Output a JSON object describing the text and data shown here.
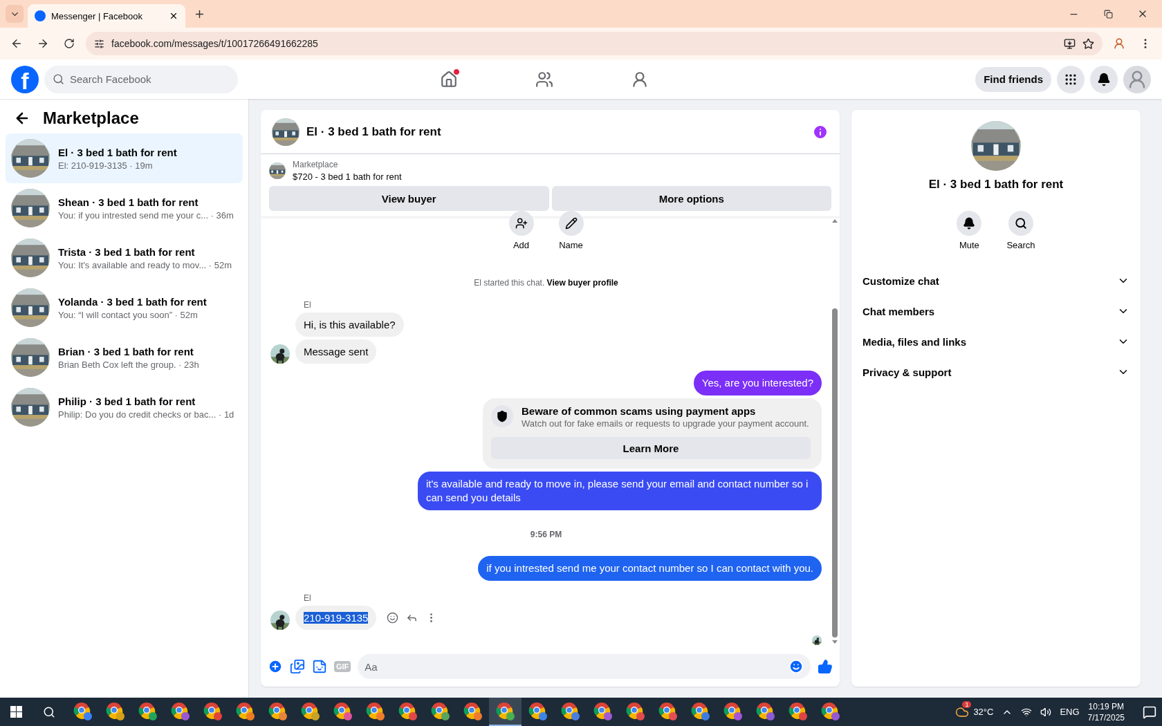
{
  "browser": {
    "tabs": [
      {
        "title": "Messenger | Facebook",
        "selected": true
      }
    ],
    "url": "facebook.com/messages/t/10017266491662285"
  },
  "header": {
    "logo": "f",
    "search_placeholder": "Search Facebook",
    "nav": [
      {
        "kind": "home",
        "badge": true,
        "selected": false
      },
      {
        "kind": "friends",
        "badge": false,
        "selected": false
      },
      {
        "kind": "groups",
        "badge": false,
        "selected": false
      }
    ],
    "find_friends": "Find friends"
  },
  "sidebar": {
    "title": "Marketplace",
    "conversations": [
      {
        "name": "El · 3 bed 1 bath for rent",
        "preview": "El: 210-919-3135 · 19m",
        "selected": true
      },
      {
        "name": "Shean · 3 bed 1 bath for rent",
        "preview": "You: if you intrested send me your c... · 36m",
        "selected": false
      },
      {
        "name": "Trista · 3 bed 1 bath for rent",
        "preview": "You: It's available and ready to mov... · 52m",
        "selected": false
      },
      {
        "name": "Yolanda · 3 bed 1 bath for rent",
        "preview": "You: “I will contact you soon” · 52m",
        "selected": false
      },
      {
        "name": "Brian · 3 bed 1 bath for rent",
        "preview": "Brian Beth Cox left the group. · 23h",
        "selected": false
      },
      {
        "name": "Philip · 3 bed 1 bath for rent",
        "preview": "Philip: Do you do credit checks or bac... · 1d",
        "selected": false
      }
    ]
  },
  "chat": {
    "title": "El · 3 bed 1 bath for rent",
    "listing": {
      "source": "Marketplace",
      "title": "$720 - 3 bed 1 bath for rent"
    },
    "buttons": [
      "View buyer",
      "More options"
    ],
    "quick_actions": [
      {
        "kind": "add",
        "label": "Add"
      },
      {
        "kind": "name",
        "label": "Name"
      }
    ],
    "messages": [
      {
        "kind": "system",
        "text": "El started this chat.",
        "link": "View buyer profile"
      },
      {
        "kind": "incoming",
        "sender": "El",
        "bubbles": [
          {
            "text": "Hi, is this available?",
            "selected": false
          },
          {
            "text": "Message sent",
            "selected": false
          }
        ],
        "actions": false
      },
      {
        "kind": "outgoing",
        "text": "Yes, are you interested?",
        "color": "#7b2ff7"
      },
      {
        "kind": "notice",
        "title": "Beware of common scams using payment apps",
        "body": "Watch out for fake emails or requests to upgrade your payment account.",
        "button": "Learn More"
      },
      {
        "kind": "outgoing",
        "text": "it's available and ready to move in, please send your email and contact number so i can send you details",
        "color": "#3a4bf3"
      },
      {
        "kind": "timestamp",
        "text": "9:56 PM"
      },
      {
        "kind": "outgoing",
        "text": "if you intrested send me your contact number so I can contact with you.",
        "color": "#1f63f1"
      },
      {
        "kind": "incoming",
        "sender": "El",
        "bubbles": [
          {
            "text": "210-919-3135",
            "selected": true
          }
        ],
        "actions": true
      },
      {
        "kind": "seen"
      }
    ],
    "composer": {
      "gif": "GIF",
      "placeholder": "Aa"
    }
  },
  "details": {
    "title": "El · 3 bed 1 bath for rent",
    "actions": [
      {
        "kind": "mute",
        "label": "Mute"
      },
      {
        "kind": "search",
        "label": "Search"
      }
    ],
    "sections": [
      {
        "label": "Customize chat",
        "expanded": false
      },
      {
        "label": "Chat members",
        "expanded": false
      },
      {
        "label": "Media, files and links",
        "expanded": false
      },
      {
        "label": "Privacy & support",
        "expanded": false
      }
    ]
  },
  "taskbar": {
    "apps": [
      {
        "color": "#3b82f6",
        "selected": false
      },
      {
        "color": "#d4a017",
        "selected": false
      },
      {
        "color": "#22a559",
        "selected": false
      },
      {
        "color": "#9b59d0",
        "selected": false
      },
      {
        "color": "#e0443a",
        "selected": false
      },
      {
        "color": "#f07c22",
        "selected": false
      },
      {
        "color": "#e8833a",
        "selected": false
      },
      {
        "color": "#c9a227",
        "selected": false
      },
      {
        "color": "#e0559a",
        "selected": false
      },
      {
        "color": "#ef7d2d",
        "selected": false
      },
      {
        "color": "#e04848",
        "selected": false
      },
      {
        "color": "#58a55c",
        "selected": false
      },
      {
        "color": "#ee7b30",
        "selected": false
      },
      {
        "color": "#4caf50",
        "selected": true
      },
      {
        "color": "#3f83e6",
        "selected": false
      },
      {
        "color": "#4a7fe0",
        "selected": false
      },
      {
        "color": "#a05ad6",
        "selected": false
      },
      {
        "color": "#e14b4b",
        "selected": false
      },
      {
        "color": "#e35050",
        "selected": false
      },
      {
        "color": "#3d7de0",
        "selected": false
      },
      {
        "color": "#a356d8",
        "selected": false
      },
      {
        "color": "#8e5bd4",
        "selected": false
      },
      {
        "color": "#de4545",
        "selected": false
      },
      {
        "color": "#9858d2",
        "selected": false
      }
    ],
    "weather": {
      "temp": "32°C",
      "badge": "1"
    },
    "language": "ENG",
    "time": "10:19 PM",
    "date": "7/17/2025"
  }
}
